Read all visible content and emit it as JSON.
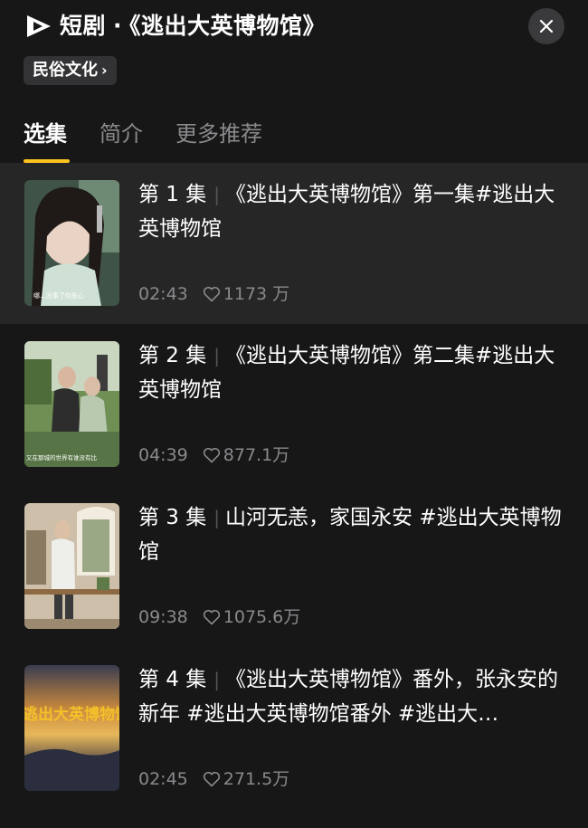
{
  "header": {
    "app_name": "短剧",
    "separator": "·",
    "drama_title": "《逃出大英博物馆》",
    "tag_label": "民俗文化",
    "tag_chevron": "›"
  },
  "tabs": [
    {
      "label": "选集",
      "active": true
    },
    {
      "label": "简介",
      "active": false
    },
    {
      "label": "更多推荐",
      "active": false
    }
  ],
  "episodes": [
    {
      "number": "第 1 集",
      "title": "《逃出大英博物馆》第一集#逃出大英博物馆",
      "duration": "02:43",
      "likes": "1173 万",
      "selected": true,
      "thumb_caption": "哪...没事了你放心"
    },
    {
      "number": "第 2 集",
      "title": "《逃出大英博物馆》第二集#逃出大英博物馆",
      "duration": "04:39",
      "likes": "877.1万",
      "selected": false,
      "thumb_caption": "又在那城的世界有谁没有比"
    },
    {
      "number": "第 3 集",
      "title": "山河无恙，家国永安 #逃出大英博物馆",
      "duration": "09:38",
      "likes": "1075.6万",
      "selected": false,
      "thumb_caption": ""
    },
    {
      "number": "第 4 集",
      "title": "《逃出大英博物馆》番外，张永安的新年 #逃出大英博物馆番外 #逃出大…",
      "duration": "02:45",
      "likes": "271.5万",
      "selected": false,
      "thumb_caption": "逃出大英博物馆"
    }
  ],
  "icons": {
    "logo": "play-logo-icon",
    "close": "close-icon",
    "like": "heart-icon"
  },
  "colors": {
    "background": "#171717",
    "selected_row": "#262626",
    "accent": "#fcc31f",
    "muted_text": "#8a8a8e"
  }
}
